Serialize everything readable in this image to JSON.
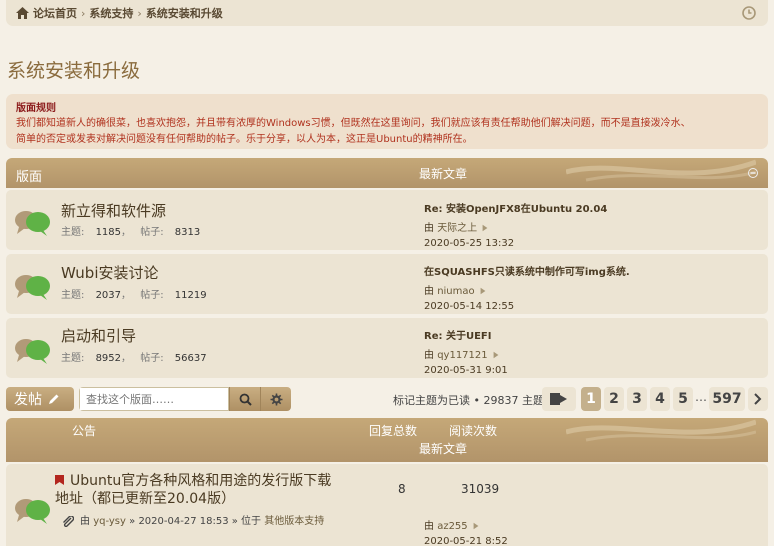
{
  "breadcrumb": [
    "论坛首页",
    "系统支持",
    "系统安装和升级"
  ],
  "page_title": "系统安装和升级",
  "rules": {
    "title": "版面规则",
    "line1": "我们都知道新人的确很菜，也喜欢抱怨，并且带有浓厚的Windows习惯，但既然在这里询问，我们就应该有责任帮助他们解决问题，而不是直接泼冷水、",
    "line2": "简单的否定或发表对解决问题没有任何帮助的帖子。乐于分享，以人为本，这正是Ubuntu的精神所在。"
  },
  "forum_header": {
    "col1": "版面",
    "col2": "最新文章"
  },
  "forums": [
    {
      "name": "新立得和软件源",
      "topics_label": "主题:",
      "topics": "1185",
      "posts_label": "帖子:",
      "posts": "8313",
      "last_title": "Re: 安装OpenJFX8在Ubuntu 20.04",
      "by": "由",
      "author": "天际之上",
      "date": "2020-05-25 13:32"
    },
    {
      "name": "Wubi安装讨论",
      "topics_label": "主题:",
      "topics": "2037",
      "posts_label": "帖子:",
      "posts": "11219",
      "last_title": "在SQUASHFS只读系统中制作可写img系统.",
      "by": "由",
      "author": "niumao",
      "date": "2020-05-14 12:55"
    },
    {
      "name": "启动和引导",
      "topics_label": "主题:",
      "topics": "8952",
      "posts_label": "帖子:",
      "posts": "56637",
      "last_title": "Re: 关于UEFI",
      "by": "由",
      "author": "qy117121",
      "date": "2020-05-31 9:01"
    }
  ],
  "action_bar": {
    "post_label": "发帖",
    "search_placeholder": "查找这个版面……",
    "mark_read": "标记主题为已读 • 29837 主题",
    "pages": [
      "1",
      "2",
      "3",
      "4",
      "5"
    ],
    "ellipsis": "…",
    "last_page": "597"
  },
  "topic_header": {
    "col1": "公告",
    "col2": "回复总数",
    "col3": "阅读次数",
    "col4": "最新文章"
  },
  "topics": [
    {
      "title_line1": "Ubuntu官方各种风格和用途的发行版下载",
      "title_line2": "地址（都已更新至20.04版）",
      "by": "由",
      "author": "yq-ysy",
      "sep": "»",
      "date": "2020-04-27 18:53",
      "in": "» 位于",
      "forum": "其他版本支持",
      "replies": "8",
      "views": "31039",
      "last_by": "由",
      "last_author": "az255",
      "last_date": "2020-05-21 8:52"
    }
  ],
  "colors": {
    "accent": "#b2946a",
    "link": "#4a3a22",
    "rules_text": "#b0321e",
    "rules_title": "#8c1b1b",
    "row_bg": "#ece4d3"
  }
}
